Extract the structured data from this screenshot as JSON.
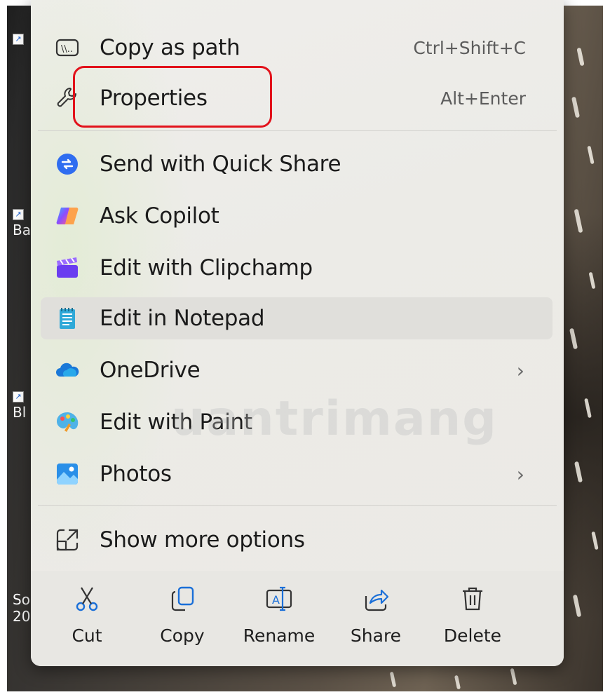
{
  "menu": {
    "items": [
      {
        "label": "Copy as path",
        "shortcut": "Ctrl+Shift+C",
        "icon": "copy-path-icon"
      },
      {
        "label": "Properties",
        "shortcut": "Alt+Enter",
        "icon": "wrench-icon"
      },
      {
        "label": "Send with Quick Share",
        "icon": "quick-share-icon"
      },
      {
        "label": "Ask Copilot",
        "icon": "copilot-icon"
      },
      {
        "label": "Edit with Clipchamp",
        "icon": "clipchamp-icon"
      },
      {
        "label": "Edit in Notepad",
        "icon": "notepad-icon"
      },
      {
        "label": "OneDrive",
        "submenu": "›",
        "icon": "onedrive-icon"
      },
      {
        "label": "Edit with Paint",
        "icon": "paint-icon"
      },
      {
        "label": "Photos",
        "submenu": "›",
        "icon": "photos-icon"
      },
      {
        "label": "Show more options",
        "icon": "show-more-icon"
      }
    ],
    "actions": [
      {
        "label": "Cut",
        "icon": "scissors-icon"
      },
      {
        "label": "Copy",
        "icon": "copy-icon"
      },
      {
        "label": "Rename",
        "icon": "rename-icon"
      },
      {
        "label": "Share",
        "icon": "share-icon"
      },
      {
        "label": "Delete",
        "icon": "trash-icon"
      }
    ]
  },
  "desktop": {
    "labels": [
      "Ba",
      "Bl",
      "So",
      "20"
    ]
  },
  "watermark": "uantrimang",
  "colors": {
    "highlight": "#e2121b",
    "menu_bg": "#efeeeb",
    "accent_blue": "#1a6fd8"
  }
}
